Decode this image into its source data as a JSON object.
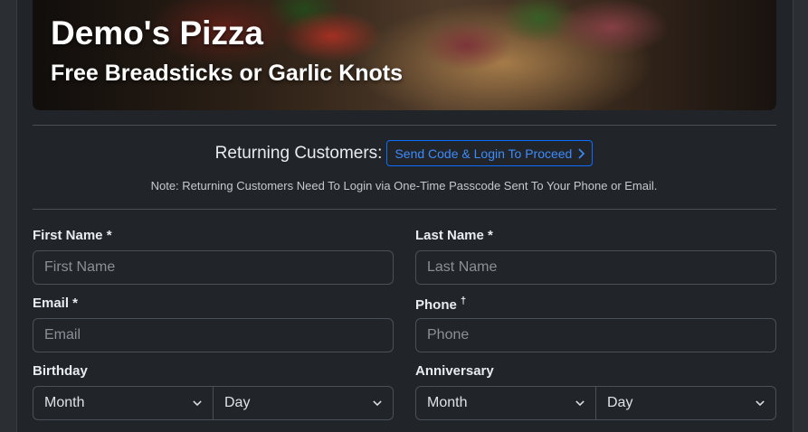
{
  "hero": {
    "title": "Demo's Pizza",
    "subtitle": "Free Breadsticks or Garlic Knots"
  },
  "returning": {
    "label": "Returning Customers:",
    "button": "Send Code & Login To Proceed",
    "note": "Note: Returning Customers Need To Login via One-Time Passcode Sent To Your Phone or Email."
  },
  "form": {
    "first_name": {
      "label": "First Name *",
      "placeholder": "First Name"
    },
    "last_name": {
      "label": "Last Name *",
      "placeholder": "Last Name"
    },
    "email": {
      "label": "Email *",
      "placeholder": "Email"
    },
    "phone": {
      "label": "Phone",
      "marker": "†",
      "placeholder": "Phone"
    },
    "birthday": {
      "label": "Birthday",
      "month": "Month",
      "day": "Day"
    },
    "anniversary": {
      "label": "Anniversary",
      "month": "Month",
      "day": "Day"
    }
  },
  "colors": {
    "accent": "#0d6efd",
    "background": "#212529"
  }
}
